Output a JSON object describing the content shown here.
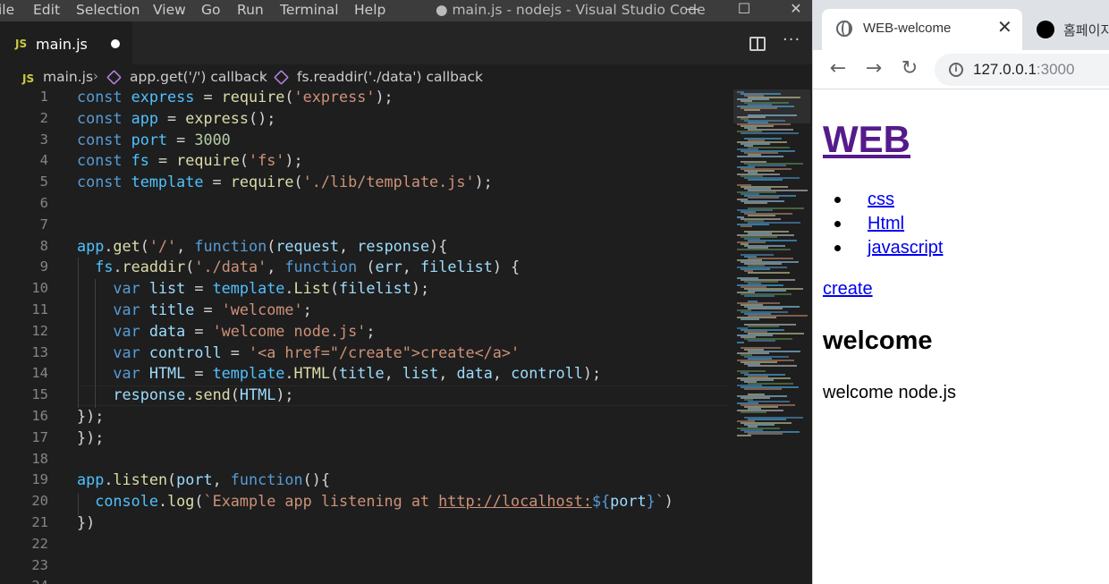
{
  "vscode": {
    "menu": [
      "ile",
      "Edit",
      "Selection",
      "View",
      "Go",
      "Run",
      "Terminal",
      "Help"
    ],
    "window_title": "● main.js - nodejs - Visual Studio Code",
    "window_controls": {
      "minimize": "—",
      "maximize": "☐",
      "close": "✕"
    },
    "tab": {
      "badge": "JS",
      "label": "main.js"
    },
    "breadcrumb": {
      "file": "main.js",
      "scope1": "app.get('/') callback",
      "scope2": "fs.readdir('./data') callback"
    },
    "minimap_colors": [
      "#569cd6",
      "#4fc1ff",
      "#ce9178",
      "#dcdcaa",
      "#9cdcfe",
      "#d4d4d4",
      "#6a9955"
    ]
  },
  "code_lines": [
    {
      "n": "1",
      "t": [
        [
          "kw",
          "const "
        ],
        [
          "vr",
          "express"
        ],
        [
          "df",
          " = "
        ],
        [
          "fn",
          "require"
        ],
        [
          "df",
          "("
        ],
        [
          "st",
          "'express'"
        ],
        [
          "df",
          ");"
        ]
      ]
    },
    {
      "n": "2",
      "t": [
        [
          "kw",
          "const "
        ],
        [
          "vr",
          "app"
        ],
        [
          "df",
          " = "
        ],
        [
          "fn",
          "express"
        ],
        [
          "df",
          "();"
        ]
      ]
    },
    {
      "n": "3",
      "t": [
        [
          "kw",
          "const "
        ],
        [
          "vr",
          "port"
        ],
        [
          "df",
          " = "
        ],
        [
          "nm",
          "3000"
        ]
      ]
    },
    {
      "n": "4",
      "t": [
        [
          "kw",
          "const "
        ],
        [
          "vr",
          "fs"
        ],
        [
          "df",
          " = "
        ],
        [
          "fn",
          "require"
        ],
        [
          "df",
          "("
        ],
        [
          "st",
          "'fs'"
        ],
        [
          "df",
          ");"
        ]
      ]
    },
    {
      "n": "5",
      "t": [
        [
          "kw",
          "const "
        ],
        [
          "vr",
          "template"
        ],
        [
          "df",
          " = "
        ],
        [
          "fn",
          "require"
        ],
        [
          "df",
          "("
        ],
        [
          "st",
          "'./lib/template.js'"
        ],
        [
          "df",
          ");"
        ]
      ]
    },
    {
      "n": "6",
      "t": []
    },
    {
      "n": "7",
      "t": []
    },
    {
      "n": "8",
      "t": [
        [
          "vr",
          "app"
        ],
        [
          "df",
          "."
        ],
        [
          "fn",
          "get"
        ],
        [
          "df",
          "("
        ],
        [
          "st",
          "'/'"
        ],
        [
          "df",
          ", "
        ],
        [
          "kw",
          "function"
        ],
        [
          "df",
          "("
        ],
        [
          "pr",
          "request"
        ],
        [
          "df",
          ", "
        ],
        [
          "pr",
          "response"
        ],
        [
          "df",
          "){"
        ]
      ]
    },
    {
      "n": "9",
      "t": [
        [
          "df",
          "  "
        ],
        [
          "vr",
          "fs"
        ],
        [
          "df",
          "."
        ],
        [
          "fn",
          "readdir"
        ],
        [
          "df",
          "("
        ],
        [
          "st",
          "'./data'"
        ],
        [
          "df",
          ", "
        ],
        [
          "kw",
          "function"
        ],
        [
          "df",
          " ("
        ],
        [
          "pr",
          "err"
        ],
        [
          "df",
          ", "
        ],
        [
          "pr",
          "filelist"
        ],
        [
          "df",
          ") {"
        ]
      ]
    },
    {
      "n": "10",
      "t": [
        [
          "df",
          "    "
        ],
        [
          "kw",
          "var "
        ],
        [
          "pr",
          "list"
        ],
        [
          "df",
          " = "
        ],
        [
          "vr",
          "template"
        ],
        [
          "df",
          "."
        ],
        [
          "fn",
          "List"
        ],
        [
          "df",
          "("
        ],
        [
          "pr",
          "filelist"
        ],
        [
          "df",
          ");"
        ]
      ]
    },
    {
      "n": "11",
      "t": [
        [
          "df",
          "    "
        ],
        [
          "kw",
          "var "
        ],
        [
          "pr",
          "title"
        ],
        [
          "df",
          " = "
        ],
        [
          "st",
          "'welcome'"
        ],
        [
          "df",
          ";"
        ]
      ]
    },
    {
      "n": "12",
      "t": [
        [
          "df",
          "    "
        ],
        [
          "kw",
          "var "
        ],
        [
          "pr",
          "data"
        ],
        [
          "df",
          " = "
        ],
        [
          "st",
          "'welcome node.js'"
        ],
        [
          "df",
          ";"
        ]
      ]
    },
    {
      "n": "13",
      "t": [
        [
          "df",
          "    "
        ],
        [
          "kw",
          "var "
        ],
        [
          "pr",
          "controll"
        ],
        [
          "df",
          " = "
        ],
        [
          "st",
          "'<a href=\"/create\">create</a>'"
        ]
      ]
    },
    {
      "n": "14",
      "t": [
        [
          "df",
          "    "
        ],
        [
          "kw",
          "var "
        ],
        [
          "pr",
          "HTML"
        ],
        [
          "df",
          " = "
        ],
        [
          "vr",
          "template"
        ],
        [
          "df",
          "."
        ],
        [
          "fn",
          "HTML"
        ],
        [
          "df",
          "("
        ],
        [
          "pr",
          "title"
        ],
        [
          "df",
          ", "
        ],
        [
          "pr",
          "list"
        ],
        [
          "df",
          ", "
        ],
        [
          "pr",
          "data"
        ],
        [
          "df",
          ", "
        ],
        [
          "pr",
          "controll"
        ],
        [
          "df",
          ");"
        ]
      ]
    },
    {
      "n": "15",
      "t": [
        [
          "df",
          "    "
        ],
        [
          "pr",
          "response"
        ],
        [
          "df",
          "."
        ],
        [
          "fn",
          "send"
        ],
        [
          "df",
          "("
        ],
        [
          "pr",
          "HTML"
        ],
        [
          "df",
          ");"
        ]
      ]
    },
    {
      "n": "16",
      "t": [
        [
          "df",
          "});"
        ]
      ]
    },
    {
      "n": "17",
      "t": [
        [
          "df",
          "});"
        ]
      ]
    },
    {
      "n": "18",
      "t": []
    },
    {
      "n": "19",
      "t": [
        [
          "vr",
          "app"
        ],
        [
          "df",
          "."
        ],
        [
          "fn",
          "listen"
        ],
        [
          "df",
          "("
        ],
        [
          "pr",
          "port"
        ],
        [
          "df",
          ", "
        ],
        [
          "kw",
          "function"
        ],
        [
          "df",
          "(){"
        ]
      ]
    },
    {
      "n": "20",
      "t": [
        [
          "df",
          "  "
        ],
        [
          "vr",
          "console"
        ],
        [
          "df",
          "."
        ],
        [
          "fn",
          "log"
        ],
        [
          "df",
          "("
        ],
        [
          "st",
          "`Example app listening at "
        ],
        [
          "lnk",
          "http://localhost:"
        ],
        [
          "tl",
          "${"
        ],
        [
          "pr",
          "port"
        ],
        [
          "tl",
          "}"
        ],
        [
          "st",
          "`"
        ],
        [
          "df",
          ")"
        ]
      ]
    },
    {
      "n": "21",
      "t": [
        [
          "df",
          "})"
        ]
      ]
    },
    {
      "n": "22",
      "t": []
    },
    {
      "n": "23",
      "t": []
    },
    {
      "n": "24",
      "t": []
    }
  ],
  "chrome": {
    "tab_title": "WEB-welcome",
    "tab_close": "✕",
    "tab2_title": "홈페이지",
    "nav": {
      "back": "←",
      "forward": "→",
      "reload": "↻"
    },
    "url_host": "127.0.0.1",
    "url_port": ":3000",
    "info_glyph": "i"
  },
  "page": {
    "h1": "WEB",
    "list": [
      "css",
      "Html",
      "javascript"
    ],
    "create": "create",
    "h2": "welcome",
    "p": "welcome node.js"
  }
}
